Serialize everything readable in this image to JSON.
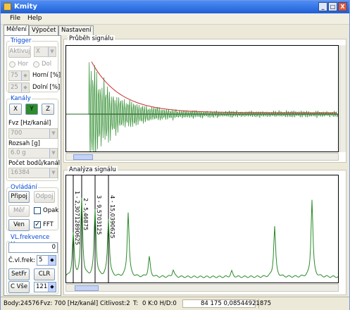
{
  "window": {
    "title": "Kmity",
    "minimize": "_",
    "maximize": "□",
    "close": "X"
  },
  "menu": [
    "File",
    "Help"
  ],
  "tabs": [
    "Měření",
    "Výpočet",
    "Nastavení"
  ],
  "trigger": {
    "legend": "Trigger",
    "aktivuj": "Aktivuj",
    "axis_select": "X",
    "radio_hor": "Hor",
    "radio_dol": "Dol",
    "horni_value": "75",
    "horni_label": "Horní [%]",
    "dolni_value": "25",
    "dolni_label": "Dolní [%]"
  },
  "kanaly": {
    "legend": "Kanály",
    "x": "X",
    "y": "Y",
    "z": "Z",
    "fvz_label": "Fvz [Hz/kanál]",
    "fvz_value": "700",
    "rozsah_label": "Rozsah [g]",
    "rozsah_value": "6.0 g",
    "pocet_label": "Počet bodů/kanál",
    "pocet_value": "16384"
  },
  "ovladani": {
    "legend": "Ovládání",
    "pripoj": "Připoj",
    "odpoj": "Odpoj",
    "mer": "Měř",
    "opak": "Opak",
    "ven": "Ven",
    "fft": "FFT"
  },
  "vlfrekvence": {
    "legend": "VL.frekvence Hz",
    "value": "0",
    "cvlfrek_label": "Č.vl.frek:",
    "cvlfrek_value": "5",
    "setfr": "SetFr",
    "clr": "CLR",
    "cvse": "C Vše",
    "cvse_value": "121"
  },
  "graph_signal": {
    "legend": "Průběh signálu"
  },
  "graph_analysis": {
    "legend": "Analýza signálu",
    "markers": [
      {
        "label": "1 - 2,30712890625"
      },
      {
        "label": "2 - 5,46875"
      },
      {
        "label": "3 - 9,5703125"
      },
      {
        "label": "4 - 15,0390625"
      }
    ]
  },
  "status": {
    "body_label": "Body:",
    "body_value": "24576",
    "fvz_label": "Fvz:",
    "fvz_value": "700 [Hz/kanál]",
    "citlivost_label": "Citlivost:",
    "citlivost_value": "2",
    "t_label": "T:",
    "k_value": "0 K:0 H/D:0",
    "progress": 0.0,
    "readout": "84 175 0,08544921875"
  },
  "colors": {
    "signal": "#2a8a2a",
    "envelope": "#c83030",
    "accent": "#0046d5"
  }
}
